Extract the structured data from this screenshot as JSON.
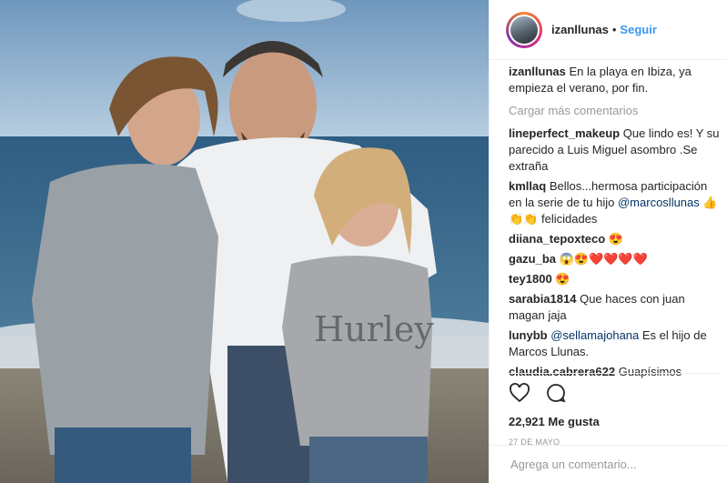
{
  "post": {
    "username": "izanllunas",
    "follow_label": "Seguir",
    "dot": "•",
    "caption": {
      "user": "izanllunas",
      "text": "En la playa en Ibiza, ya empieza el verano, por fin."
    },
    "load_more": "Cargar más comentarios",
    "comments": [
      {
        "user": "lineperfect_makeup",
        "text": "Que lindo es! Y su parecido a Luis Miguel asombro .Se extraña"
      },
      {
        "user": "kmllaq",
        "text_before": "Bellos...hermosa participación en la serie de tu hijo",
        "mention": "@marcosllunas",
        "text_after": "felicidades",
        "emoji": "👍👏👏"
      },
      {
        "user": "diiana_tepoxteco",
        "emoji": "😍"
      },
      {
        "user": "gazu_ba",
        "emoji": "😱😍❤️❤️❤️❤️"
      },
      {
        "user": "tey1800",
        "emoji": "😍"
      },
      {
        "user": "sarabia1814",
        "text": "Que haces con juan magan jaja"
      },
      {
        "user": "lunybb",
        "mention": "@sellamajohana",
        "text": "Es el hijo de Marcos Llunas."
      },
      {
        "user": "claudia.cabrera622",
        "text": "Guapísimos"
      }
    ],
    "likes": "22,921 Me gusta",
    "date": "27 DE MAYO",
    "add_comment_placeholder": "Agrega un comentario..."
  },
  "icons": {
    "like": "heart-outline-icon",
    "comment": "speech-bubble-icon"
  },
  "colors": {
    "link": "#3897f0",
    "mention": "#003569",
    "muted": "#999999",
    "text": "#262626"
  }
}
